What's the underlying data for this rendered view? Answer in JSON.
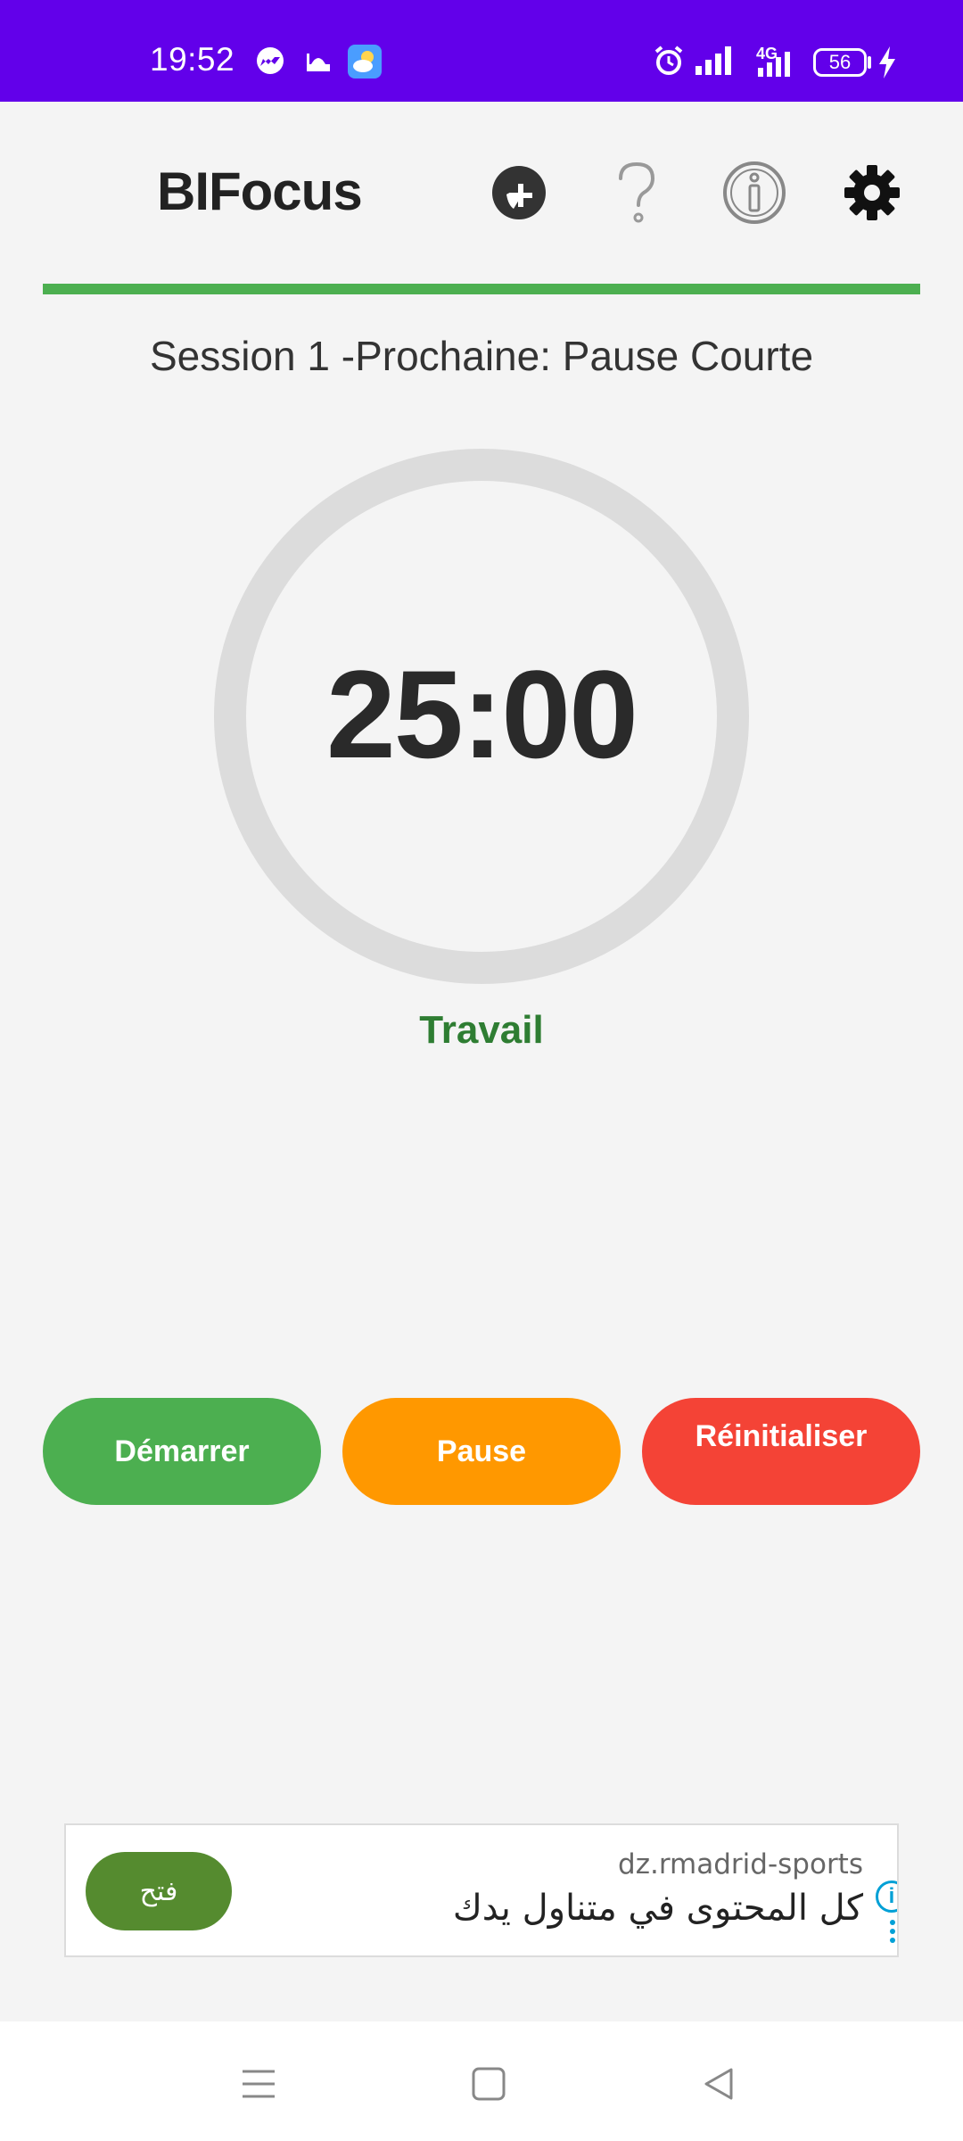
{
  "status_bar": {
    "time": "19:52",
    "background_color": "#6200ea",
    "icons": [
      "messenger-icon",
      "mosque-icon",
      "weather-icon",
      "alarm-icon",
      "signal-icon",
      "signal-4g-icon",
      "charging-icon"
    ],
    "network_label": "4G",
    "battery_level": "56"
  },
  "header": {
    "title": "BIFocus",
    "actions": [
      "add-task-icon",
      "help-icon",
      "info-icon",
      "settings-icon"
    ]
  },
  "progress": {
    "color": "#4caf50",
    "fraction": 1.0
  },
  "session_label": "Session 1 -Prochaine: Pause Courte",
  "timer": {
    "display": "25:00",
    "ring_color": "#dcdcdc",
    "mode": "Travail",
    "mode_color": "#2e7d32"
  },
  "controls": {
    "start_label": "Démarrer",
    "start_color": "#4caf50",
    "pause_label": "Pause",
    "pause_color": "#ff9800",
    "reset_label": "Réinitialiser",
    "reset_color": "#f44336"
  },
  "ad": {
    "button_label": "فتح",
    "domain": "dz.rmadrid-sports",
    "headline": "كل المحتوى في متناول يدك",
    "info_label": "i"
  },
  "nav_bar": {
    "icons": [
      "menu-icon",
      "home-icon",
      "back-icon"
    ]
  }
}
